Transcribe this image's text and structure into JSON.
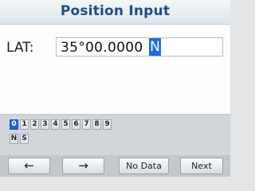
{
  "titlebar": {
    "title": "Position Input"
  },
  "lat": {
    "label": "LAT:",
    "value": "35°00.0000",
    "direction": "N"
  },
  "keyboard": {
    "digits": [
      "0",
      "1",
      "2",
      "3",
      "4",
      "5",
      "6",
      "7",
      "8",
      "9"
    ],
    "letters": [
      "N",
      "S"
    ],
    "selected_key": "0"
  },
  "softkeys": {
    "back": "←",
    "forward": "→",
    "no_data": "No Data",
    "next": "Next"
  }
}
